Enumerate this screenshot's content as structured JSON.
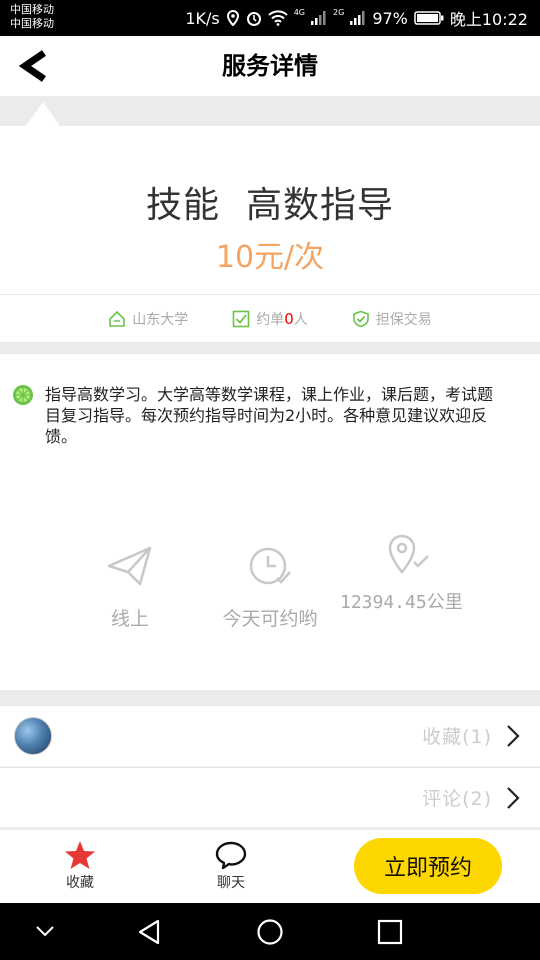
{
  "status_bar": {
    "carrier_1": "中国移动",
    "carrier_2": "中国移动",
    "speed": "1K/s",
    "network_4g": "4G",
    "network_2g": "2G",
    "battery": "97%",
    "time": "晚上10:22"
  },
  "header": {
    "title": "服务详情"
  },
  "service": {
    "category": "技能",
    "name": "高数指导",
    "price": "10元/次"
  },
  "tags": {
    "school": "山东大学",
    "orders_prefix": "约单",
    "orders_count": "0",
    "orders_suffix": "人",
    "guarantee": "担保交易"
  },
  "description": "指导高数学习。大学高等数学课程，课上作业，课后题，考试题目复习指导。每次预约指导时间为2小时。各种意见建议欢迎反馈。",
  "features": {
    "mode": "线上",
    "availability": "今天可约哟",
    "distance": "12394.45公里"
  },
  "rows": {
    "favorites": "收藏(1)",
    "comments": "评论(2)"
  },
  "tabbar": {
    "favorite": "收藏",
    "chat": "聊天",
    "book_now": "立即预约"
  },
  "colors": {
    "accent_yellow": "#ffd700",
    "price_orange": "#f4a460",
    "tag_green": "#6cc24a",
    "star_red": "#e53935"
  }
}
